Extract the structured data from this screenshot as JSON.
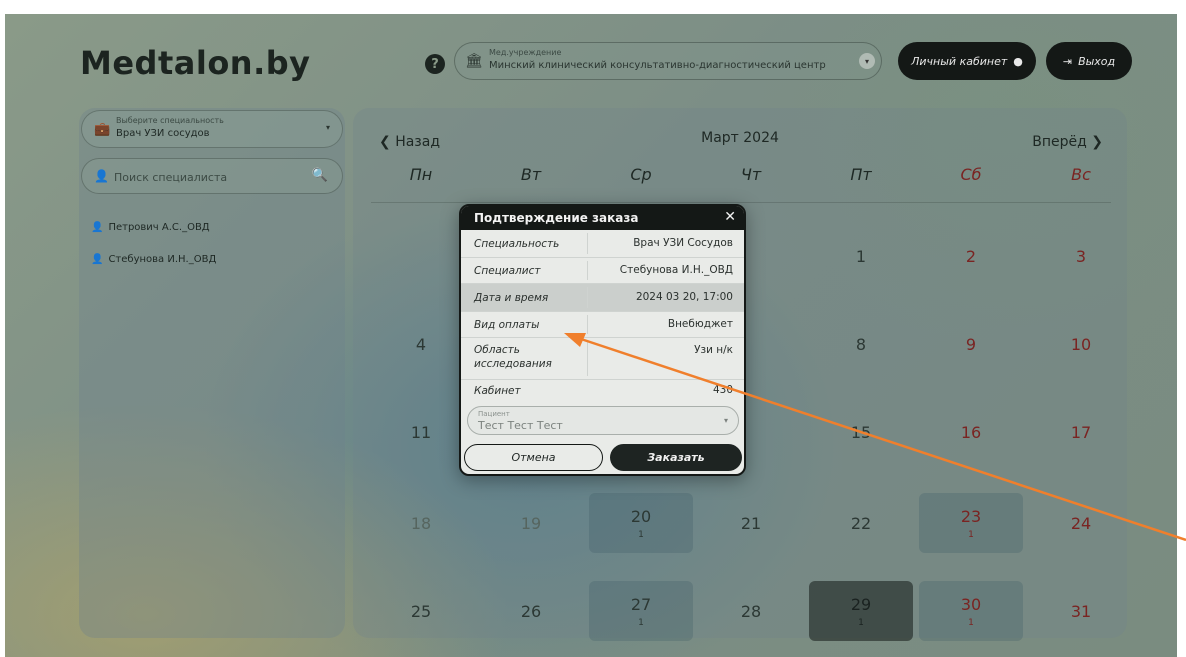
{
  "header": {
    "logo": "Medtalon.by",
    "help_icon": "?",
    "institution_label": "Мед.учреждение",
    "institution_value": "Минский клинический консультативно-диагностический центр",
    "cabinet_label": "Личный кабинет",
    "logout_label": "Выход"
  },
  "sidebar": {
    "specialty_label": "Выберите специальность",
    "specialty_value": "Врач УЗИ сосудов",
    "search_placeholder": "Поиск специалиста",
    "doctors": [
      "Петрович А.С._ОВД",
      "Стебунова И.Н._ОВД"
    ]
  },
  "calendar": {
    "prev_label": "Назад",
    "next_label": "Вперёд",
    "month_title": "Март 2024",
    "weekdays": [
      "Пн",
      "Вт",
      "Ср",
      "Чт",
      "Пт",
      "Сб",
      "Вс"
    ],
    "weeks": [
      [
        {
          "d": ""
        },
        {
          "d": ""
        },
        {
          "d": ""
        },
        {
          "d": ""
        },
        {
          "d": "1"
        },
        {
          "d": "2"
        },
        {
          "d": "3"
        }
      ],
      [
        {
          "d": "4"
        },
        {
          "d": ""
        },
        {
          "d": ""
        },
        {
          "d": ""
        },
        {
          "d": "8"
        },
        {
          "d": "9"
        },
        {
          "d": "10"
        }
      ],
      [
        {
          "d": "11"
        },
        {
          "d": ""
        },
        {
          "d": ""
        },
        {
          "d": ""
        },
        {
          "d": "15"
        },
        {
          "d": "16"
        },
        {
          "d": "17"
        }
      ],
      [
        {
          "d": "18",
          "m": true
        },
        {
          "d": "19",
          "m": true
        },
        {
          "d": "20",
          "c": "1",
          "s": "avail"
        },
        {
          "d": "21"
        },
        {
          "d": "22"
        },
        {
          "d": "23",
          "c": "1",
          "s": "avail"
        },
        {
          "d": "24"
        }
      ],
      [
        {
          "d": "25"
        },
        {
          "d": "26"
        },
        {
          "d": "27",
          "c": "1",
          "s": "avail"
        },
        {
          "d": "28"
        },
        {
          "d": "29",
          "c": "1",
          "s": "dark"
        },
        {
          "d": "30",
          "c": "1",
          "s": "avail"
        },
        {
          "d": "31"
        }
      ]
    ]
  },
  "modal": {
    "title": "Подтверждение заказа",
    "close_icon": "✕",
    "rows": [
      {
        "label": "Специальность",
        "value": "Врач УЗИ Сосудов"
      },
      {
        "label": "Специалист",
        "value": "Стебунова И.Н._ОВД"
      },
      {
        "label": "Дата и время",
        "value": "2024 03 20, 17:00"
      },
      {
        "label": "Вид оплаты",
        "value": "Внебюджет"
      },
      {
        "label": "Область исследования",
        "value": "Узи н/к"
      },
      {
        "label": "Кабинет",
        "value": "430"
      }
    ],
    "patient_label": "Пациент",
    "patient_value": "Тест Тест Тест",
    "cancel_label": "Отмена",
    "order_label": "Заказать"
  },
  "colors": {
    "accent_dark": "#141816",
    "weekend": "#7a2422",
    "annotation_arrow": "#f07f2c"
  }
}
